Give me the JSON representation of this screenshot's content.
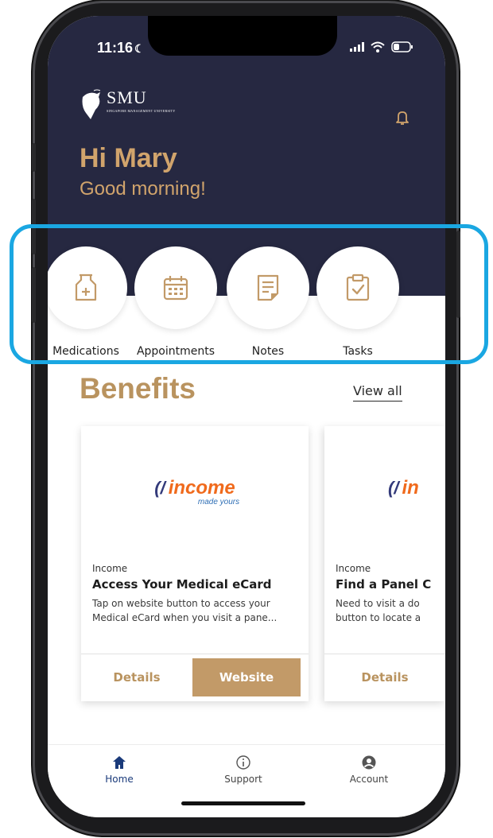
{
  "status_bar": {
    "time": "11:16",
    "moon_glyph": "☾"
  },
  "header": {
    "logo_main": "SMU",
    "logo_sub": "SINGAPORE MANAGEMENT UNIVERSITY",
    "greeting_name": "Hi Mary",
    "greeting_sub": "Good morning!"
  },
  "quick_actions": [
    {
      "label": "Medications",
      "icon": "medication-bottle-icon"
    },
    {
      "label": "Appointments",
      "icon": "calendar-icon"
    },
    {
      "label": "Notes",
      "icon": "notes-icon"
    },
    {
      "label": "Tasks",
      "icon": "clipboard-check-icon"
    }
  ],
  "benefits": {
    "title": "Benefits",
    "view_all": "View all",
    "cards": [
      {
        "logo_mark": "(/",
        "logo_word": "income",
        "logo_tag": "made yours",
        "provider": "Income",
        "title": "Access Your Medical eCard",
        "description": "Tap on website button to access your Medical eCard when you visit a pane...",
        "details_label": "Details",
        "website_label": "Website"
      },
      {
        "logo_mark": "(/",
        "logo_word": "in",
        "provider": "Income",
        "title": "Find a Panel C",
        "description": "Need to visit a do button to locate a",
        "details_label": "Details"
      }
    ]
  },
  "bottom_nav": [
    {
      "label": "Home",
      "icon": "home-icon",
      "active": true
    },
    {
      "label": "Support",
      "icon": "info-icon",
      "active": false
    },
    {
      "label": "Account",
      "icon": "account-icon",
      "active": false
    }
  ],
  "colors": {
    "header_bg": "#262841",
    "gold": "#d1a46c",
    "accent_gold": "#b9935f",
    "highlight": "#1aa7e2",
    "nav_active": "#1a3a7a"
  }
}
